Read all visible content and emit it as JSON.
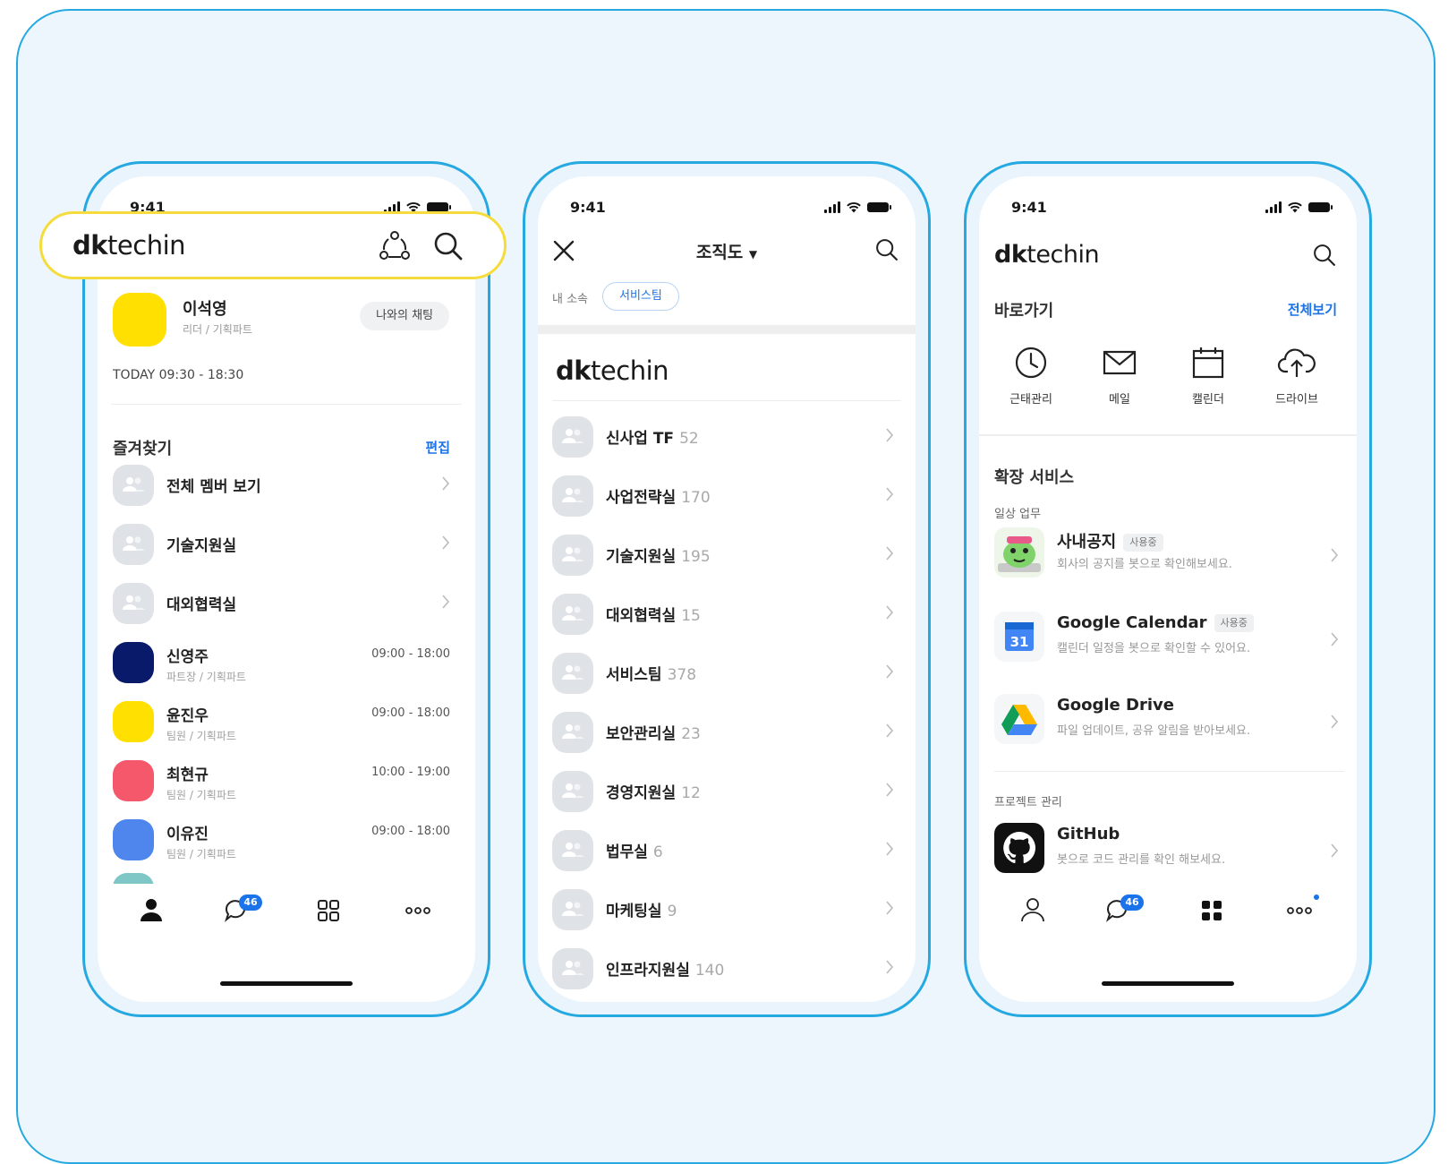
{
  "status": {
    "time": "9:41"
  },
  "phone1": {
    "logo": {
      "bold": "dk",
      "regular": "techin"
    },
    "profile": {
      "name": "이석영",
      "role": "리더 / 기획파트",
      "chat_button": "나와의 채팅"
    },
    "today": "TODAY  09:30 - 18:30",
    "favorites": {
      "title": "즐겨찾기",
      "edit": "편집",
      "groups": [
        {
          "label": "전체 멤버 보기"
        },
        {
          "label": "기술지원실"
        },
        {
          "label": "대외협력실"
        }
      ],
      "members": [
        {
          "name": "신영주",
          "role": "파트장 / 기획파트",
          "time": "09:00 - 18:00",
          "color": "#0a1a6b"
        },
        {
          "name": "윤진우",
          "role": "팀원 / 기획파트",
          "time": "09:00 - 18:00",
          "color": "#ffe000"
        },
        {
          "name": "최현규",
          "role": "팀원 / 기획파트",
          "time": "10:00 - 19:00",
          "color": "#f5586a"
        },
        {
          "name": "이유진",
          "role": "팀원 / 기획파트",
          "time": "09:00 - 18:00",
          "color": "#4f86ee"
        }
      ]
    },
    "tab_badge": "46",
    "profile_color": "#ffe000"
  },
  "phone2": {
    "title": "조직도",
    "my_dept_label": "내 소속",
    "my_dept_chip": "서비스팀",
    "logo": {
      "bold": "dk",
      "regular": "techin"
    },
    "departments": [
      {
        "name": "신사업 TF",
        "count": "52"
      },
      {
        "name": "사업전략실",
        "count": "170"
      },
      {
        "name": "기술지원실",
        "count": "195"
      },
      {
        "name": "대외협력실",
        "count": "15"
      },
      {
        "name": "서비스팀",
        "count": "378"
      },
      {
        "name": "보안관리실",
        "count": "23"
      },
      {
        "name": "경영지원실",
        "count": "12"
      },
      {
        "name": "법무실",
        "count": "6"
      },
      {
        "name": "마케팅실",
        "count": "9"
      },
      {
        "name": "인프라지원실",
        "count": "140"
      }
    ]
  },
  "phone3": {
    "logo": {
      "bold": "dk",
      "regular": "techin"
    },
    "shortcuts": {
      "title": "바로가기",
      "view_all": "전체보기",
      "items": [
        {
          "label": "근태관리",
          "icon": "clock-icon"
        },
        {
          "label": "메일",
          "icon": "mail-icon"
        },
        {
          "label": "캘린더",
          "icon": "calendar-icon"
        },
        {
          "label": "드라이브",
          "icon": "cloud-upload-icon"
        }
      ]
    },
    "extensions": {
      "title": "확장 서비스",
      "daily": "일상 업무",
      "project": "프로젝트 관리",
      "services": [
        {
          "title": "사내공지",
          "tag": "사용중",
          "desc": "회사의 공지를 봇으로 확인해보세요."
        },
        {
          "title": "Google Calendar",
          "tag": "사용중",
          "desc": "캘린더 일정을 봇으로 확인할 수 있어요.",
          "icon_text": "31"
        },
        {
          "title": "Google Drive",
          "tag": "",
          "desc": "파일 업데이트, 공유 알림을 받아보세요."
        },
        {
          "title": "GitHub",
          "tag": "",
          "desc": "봇으로 코드 관리를 확인 해보세요."
        }
      ]
    },
    "tab_badge": "46"
  },
  "colors": {
    "accent": "#1a73e8",
    "frame": "#26a9e0",
    "highlight": "#f5dc3c"
  }
}
